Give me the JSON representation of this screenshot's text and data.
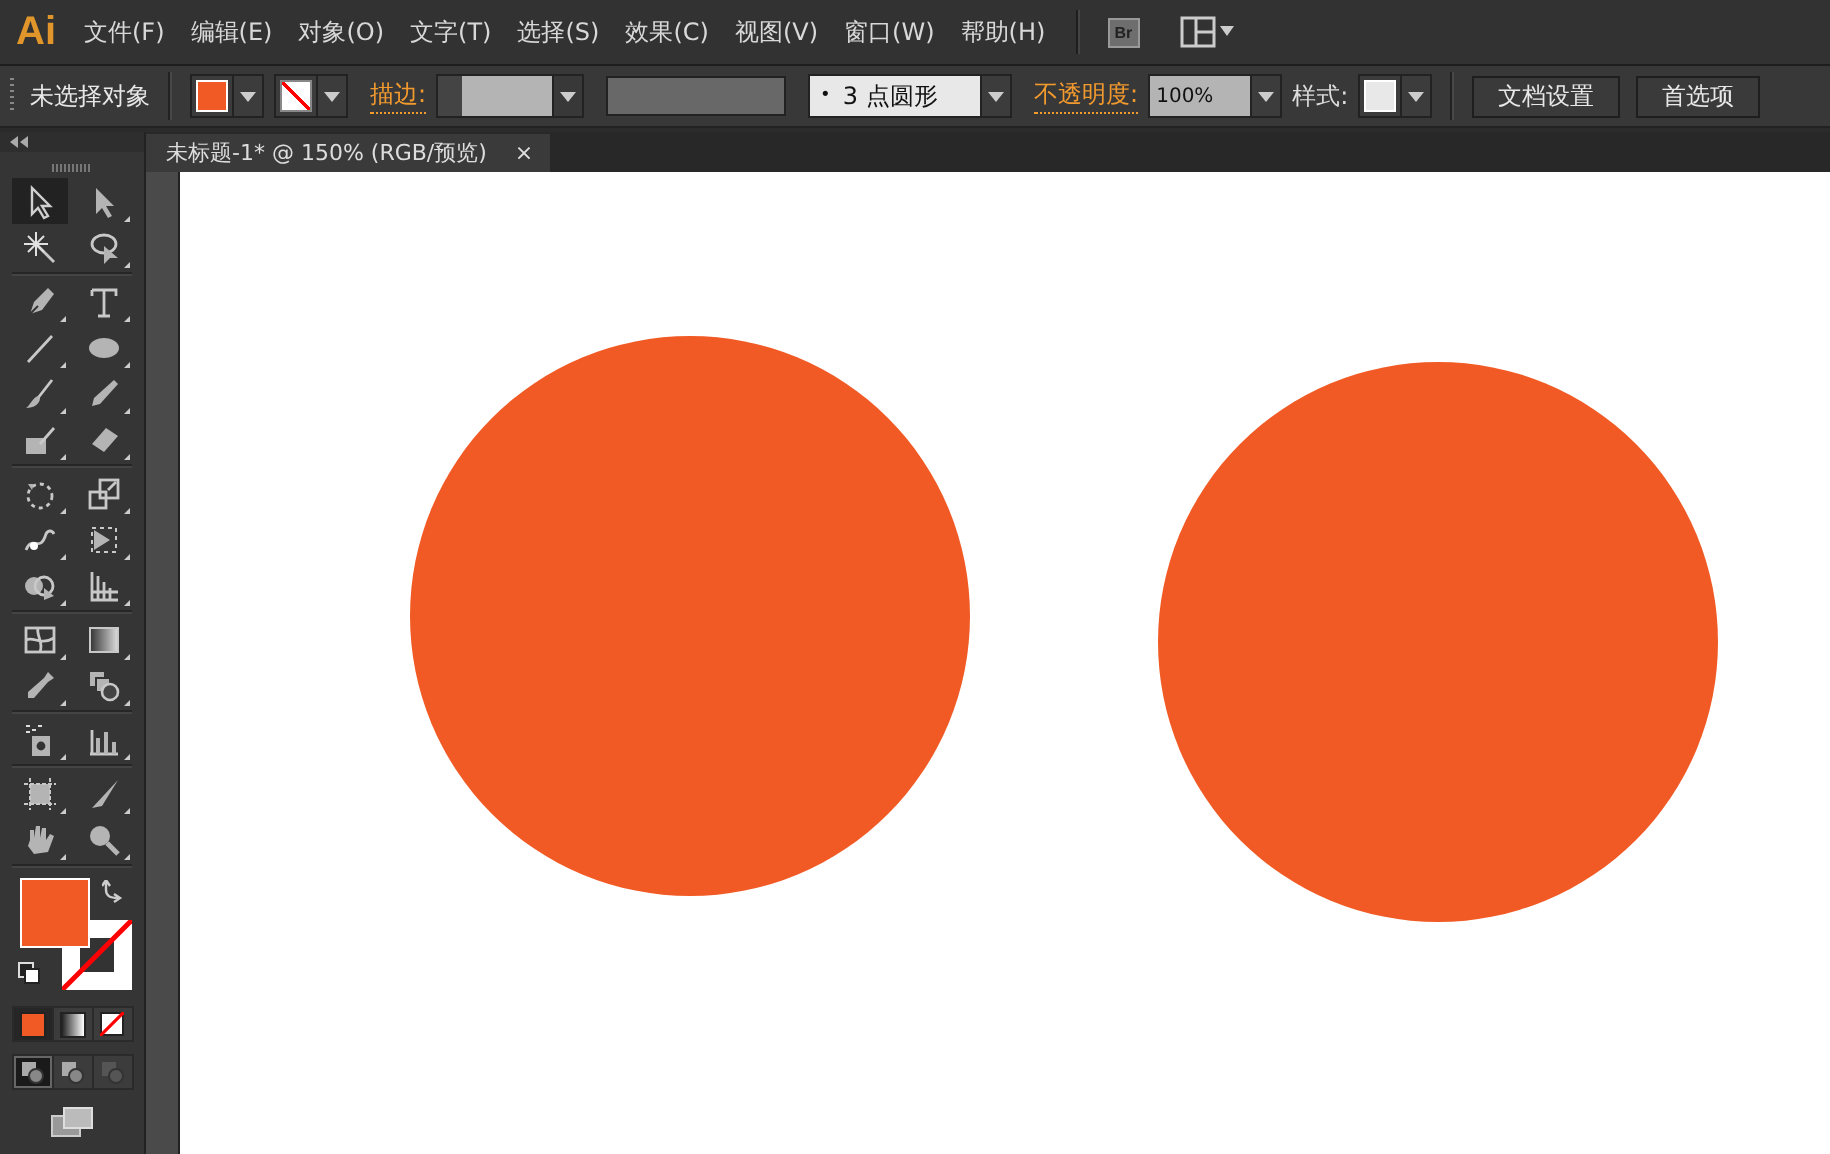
{
  "menu_bar": {
    "logo": "Ai",
    "items": [
      "文件(F)",
      "编辑(E)",
      "对象(O)",
      "文字(T)",
      "选择(S)",
      "效果(C)",
      "视图(V)",
      "窗口(W)",
      "帮助(H)"
    ],
    "bridge_badge": "Br"
  },
  "control_bar": {
    "selection_label": "未选择对象",
    "stroke_label": "描边:",
    "brush_dot": "•",
    "brush": "3 点圆形",
    "opacity_label": "不透明度:",
    "opacity": "100%",
    "style_label": "样式:",
    "buttons": [
      "文档设置",
      "首选项"
    ]
  },
  "document_tab": {
    "title": "未标题-1* @ 150% (RGB/预览)",
    "close": "×"
  },
  "tools": [
    {
      "selected": true
    },
    {
      "selected": false
    },
    {
      "selected": false
    },
    {
      "selected": false
    },
    {
      "selected": false
    },
    {
      "selected": false
    },
    {
      "selected": false
    },
    {
      "selected": false
    },
    {
      "selected": false
    },
    {
      "selected": false
    },
    {
      "selected": false
    },
    {
      "selected": false
    },
    {
      "selected": false
    },
    {
      "selected": false
    },
    {
      "selected": false
    },
    {
      "selected": false
    },
    {
      "selected": false
    },
    {
      "selected": false
    },
    {
      "selected": false
    },
    {
      "selected": false
    },
    {
      "selected": false
    },
    {
      "selected": false
    },
    {
      "selected": false
    },
    {
      "selected": false
    },
    {
      "selected": false
    },
    {
      "selected": false
    },
    {
      "selected": false
    },
    {
      "selected": false
    }
  ],
  "draw_modes": [
    {
      "selected": true
    },
    {
      "selected": false
    },
    {
      "selected": false
    }
  ]
}
